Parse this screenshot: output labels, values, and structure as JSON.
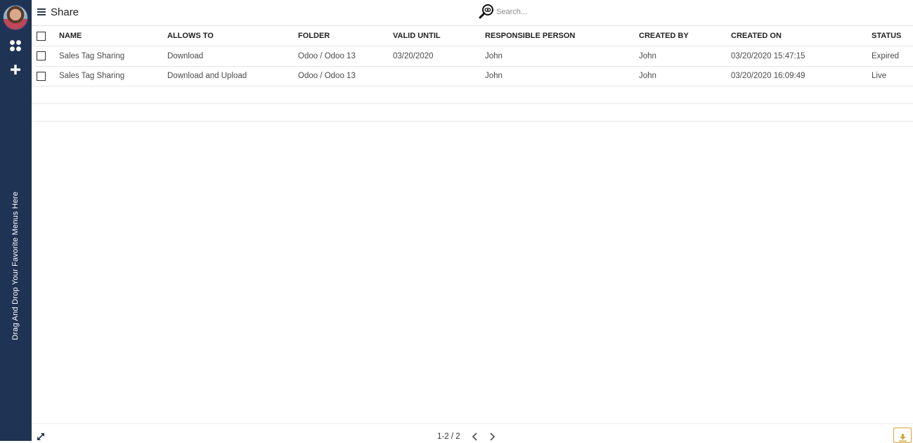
{
  "sidebar": {
    "favorites_hint": "Drag And Drop Your Favorite Menus Here"
  },
  "header": {
    "title": "Share",
    "search_placeholder": "Search..."
  },
  "table": {
    "columns": [
      "NAME",
      "ALLOWS TO",
      "FOLDER",
      "VALID UNTIL",
      "RESPONSIBLE PERSON",
      "CREATED BY",
      "CREATED ON",
      "STATUS"
    ],
    "rows": [
      [
        "Sales Tag Sharing",
        "Download",
        "Odoo / Odoo 13",
        "03/20/2020",
        "John",
        "John",
        "03/20/2020 15:47:15",
        "Expired"
      ],
      [
        "Sales Tag Sharing",
        "Download and Upload",
        "Odoo / Odoo 13",
        "",
        "John",
        "John",
        "03/20/2020 16:09:49",
        "Live"
      ]
    ]
  },
  "pager": {
    "range": "1-2 / 2"
  },
  "colors": {
    "sidebar": "#1f3454",
    "accent": "#d4a63a"
  }
}
